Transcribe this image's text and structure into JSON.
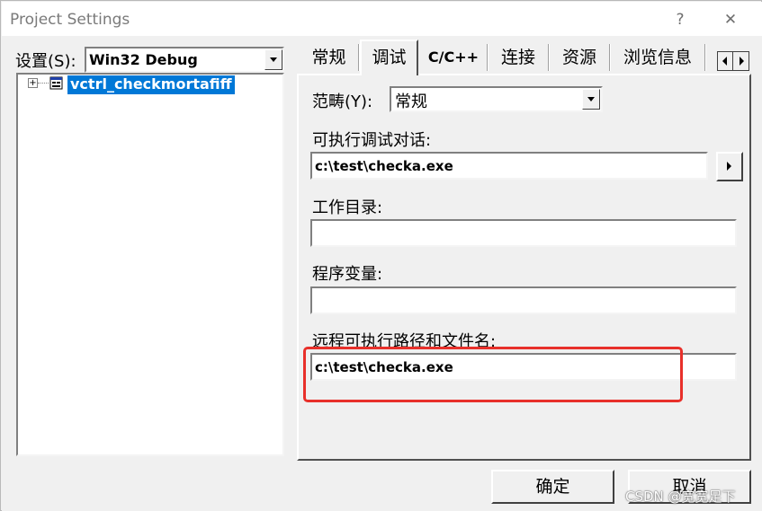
{
  "window": {
    "title": "Project Settings",
    "help_label": "?",
    "close_label": "✕"
  },
  "settings": {
    "label": "设置(S):",
    "selected": "Win32 Debug"
  },
  "tree": {
    "project_name": "vctrl_checkmortafiff",
    "expander": "⊞"
  },
  "tabs": [
    {
      "label": "常规",
      "active": false
    },
    {
      "label": "调试",
      "active": true
    },
    {
      "label": "C/C++",
      "active": false
    },
    {
      "label": "连接",
      "active": false
    },
    {
      "label": "资源",
      "active": false
    },
    {
      "label": "浏览信息",
      "active": false
    }
  ],
  "debug": {
    "category_label": "范畴(Y):",
    "category_value": "常规",
    "executable_label": "可执行调试对话:",
    "executable_value": "c:\\test\\checka.exe",
    "working_dir_label": "工作目录:",
    "working_dir_value": "",
    "program_args_label": "程序变量:",
    "program_args_value": "",
    "remote_label": "远程可执行路径和文件名:",
    "remote_value": "c:\\test\\checka.exe"
  },
  "buttons": {
    "ok": "确定",
    "cancel": "取消"
  },
  "watermark": "CSDN @宽宽足下",
  "colors": {
    "highlight": "#0078d7",
    "annotation_box": "#e8302a"
  }
}
